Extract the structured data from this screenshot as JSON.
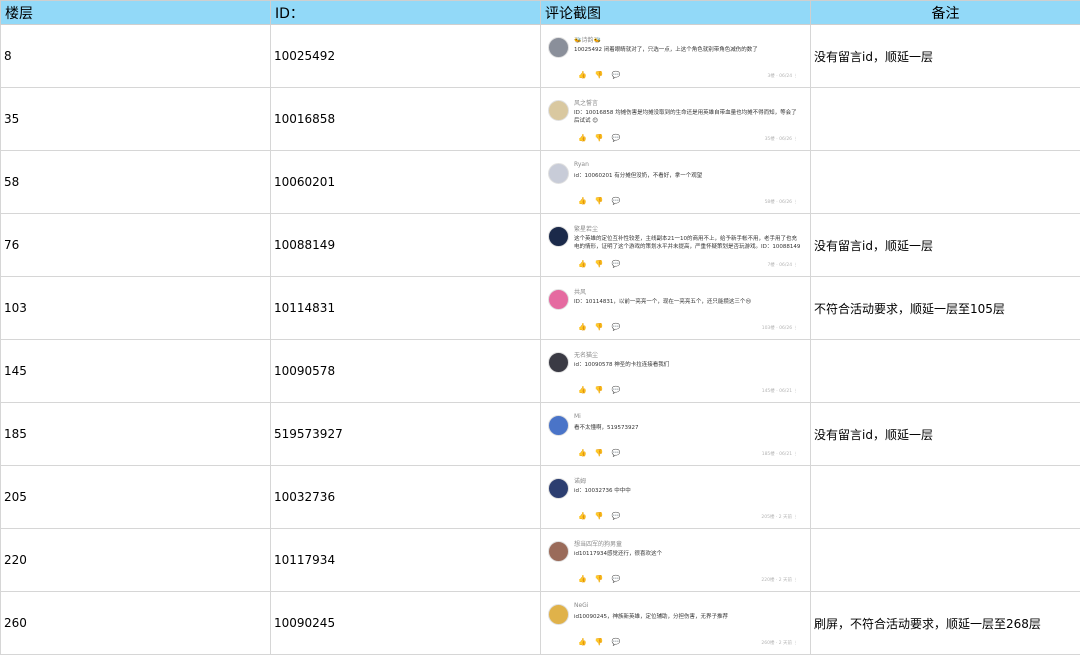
{
  "headers": [
    "楼层",
    "ID：",
    "评论截图",
    "备注"
  ],
  "rows": [
    {
      "floor": "8",
      "id": "10025492",
      "note": "没有留言id，顺延一层",
      "cmt": {
        "user": "🐝诗韵🐝",
        "text": "10025492  闭着眼睛就对了，只选一点，上这个角色就别带角色减伤的数了",
        "meta": "3楼 · 06/24",
        "av": "#8a8f9a"
      }
    },
    {
      "floor": "35",
      "id": "10016858",
      "note": "",
      "cmt": {
        "user": "风之誓言",
        "text": "ID：10016858  均摊伤害是均摊没取到的生命还是用英雄自带血量也均摊不得而知，等会了后试试 😊",
        "meta": "35楼 · 06/26",
        "av": "#d9c8a0"
      }
    },
    {
      "floor": "58",
      "id": "10060201",
      "note": "",
      "cmt": {
        "user": "Ryan",
        "text": "id：10060201  有分摊但没奶，不看好，拿一个观望",
        "meta": "58楼 · 06/26",
        "av": "#c8ccd8"
      }
    },
    {
      "floor": "76",
      "id": "10088149",
      "note": "没有留言id，顺延一层",
      "cmt": {
        "user": "繁星若尘",
        "text": "这个英雄的定位互补性较差，主线副本21一10的商用不上，给予新手帐不用，老手用了也充电的情形，证明了这个游戏的策划水平并未提高，严重怀疑策划是否玩游戏。ID：10088149",
        "meta": "7楼 · 06/24",
        "av": "#1b2a4a"
      }
    },
    {
      "floor": "103",
      "id": "10114831",
      "note": "不符合活动要求，顺延一层至105层",
      "cmt": {
        "user": "共风",
        "text": "ID：10114831，以前一亮亮一个，现在一亮亮五个，还只能攒这三个😢",
        "meta": "103楼 · 06/26",
        "av": "#e56aa0"
      }
    },
    {
      "floor": "145",
      "id": "10090578",
      "note": "",
      "cmt": {
        "user": "无名猫尘",
        "text": "id：10090578  神圣的卡拉连接看我们",
        "meta": "145楼 · 06/21",
        "av": "#3a3a44"
      }
    },
    {
      "floor": "185",
      "id": "519573927",
      "note": "没有留言id，顺延一层",
      "cmt": {
        "user": "Mi",
        "text": "看不太懂啊，519573927",
        "meta": "185楼 · 06/21",
        "av": "#4a74c8"
      }
    },
    {
      "floor": "205",
      "id": "10032736",
      "note": "",
      "cmt": {
        "user": "诺姆",
        "text": "id：10032736  中中中",
        "meta": "205楼 · 2 天前",
        "av": "#2c3e70"
      }
    },
    {
      "floor": "220",
      "id": "10117934",
      "note": "",
      "cmt": {
        "user": "想当四军的狗男童",
        "text": "id10117934感觉还行，很喜欢这个",
        "meta": "220楼 · 2 天前",
        "av": "#9a6b5a"
      }
    },
    {
      "floor": "260",
      "id": "10090245",
      "note": "刷屏，不符合活动要求，顺延一层至268层",
      "cmt": {
        "user": "NeGi",
        "text": "id10090245，神族新英雄，定位辅助，分担伤害，无界子推荐",
        "meta": "260楼 · 2 天前",
        "av": "#e0b24a"
      }
    }
  ],
  "icons": {
    "like": "thumb-up-icon",
    "dislike": "thumb-down-icon",
    "reply": "comment-icon",
    "more": "more-icon"
  }
}
